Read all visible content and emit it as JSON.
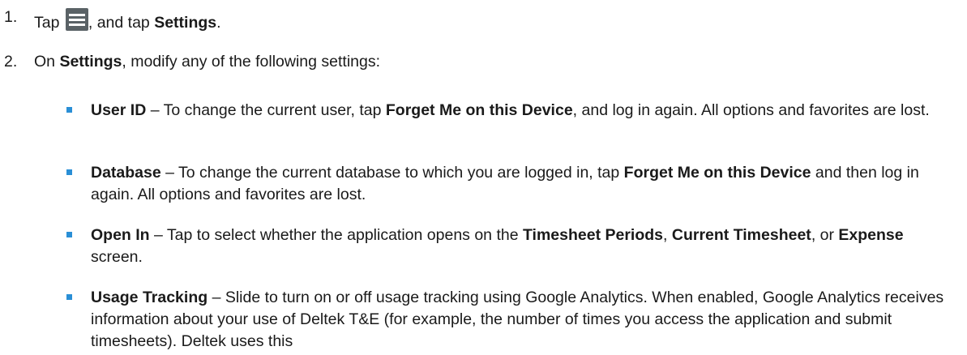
{
  "steps": [
    {
      "number": "1.",
      "pre": "Tap ",
      "icon": "hamburger-menu-icon",
      "mid": ", and tap ",
      "bold": "Settings",
      "post": "."
    },
    {
      "number": "2.",
      "pre": "On ",
      "bold": "Settings",
      "post": ", modify any of the following settings:"
    }
  ],
  "settings": [
    {
      "term": "User ID",
      "t1": " – To change the current user, tap ",
      "b1": "Forget Me on this Device",
      "t2": ", and log in again. All options and favorites are lost."
    },
    {
      "term": "Database",
      "t1": " – To change the current database to which you are logged in, tap ",
      "b1": "Forget Me on this Device",
      "t2": " and then log in again. All options and favorites are lost."
    },
    {
      "term": "Open In",
      "t1": " – Tap to select whether the application opens on the ",
      "b1": "Timesheet Periods",
      "t2": ", ",
      "b2": "Current Timesheet",
      "t3": ", or ",
      "b3": "Expense",
      "t4": " screen."
    },
    {
      "term": "Usage Tracking",
      "t1": " – Slide to turn on or off usage tracking using Google Analytics. When enabled, Google Analytics receives information about your use of Deltek T&E (for example, the number of times you access the application and submit timesheets). Deltek uses this"
    }
  ],
  "colors": {
    "bullet": "#2a8fd6",
    "icon_bg": "#5a6266"
  }
}
